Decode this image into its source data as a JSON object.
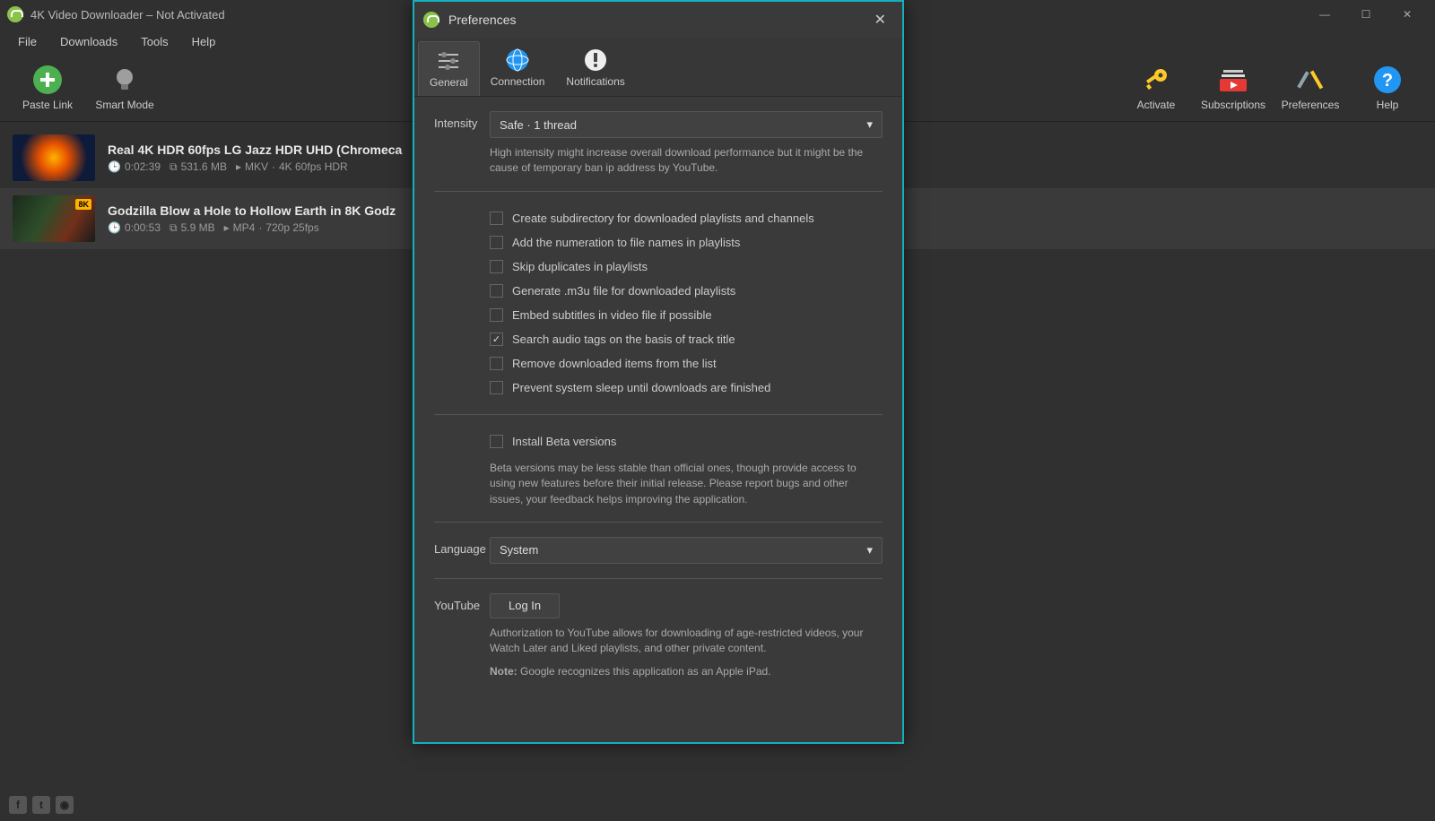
{
  "window": {
    "title": "4K Video Downloader – Not Activated"
  },
  "menu": {
    "file": "File",
    "downloads": "Downloads",
    "tools": "Tools",
    "help": "Help"
  },
  "toolbar": {
    "paste": "Paste Link",
    "smart": "Smart Mode",
    "activate": "Activate",
    "subscriptions": "Subscriptions",
    "preferences": "Preferences",
    "help": "Help"
  },
  "downloads": [
    {
      "title": "Real 4K HDR 60fps LG Jazz HDR UHD (Chromeca",
      "duration": "0:02:39",
      "size": "531.6 MB",
      "container": "MKV",
      "quality": "4K 60fps  HDR"
    },
    {
      "title": "Godzilla Blow a Hole to Hollow Earth in 8K   Godz",
      "duration": "0:00:53",
      "size": "5.9 MB",
      "container": "MP4",
      "quality": "720p 25fps"
    }
  ],
  "prefs": {
    "title": "Preferences",
    "tabs": {
      "general": "General",
      "connection": "Connection",
      "notifications": "Notifications"
    },
    "intensity": {
      "label": "Intensity",
      "value": "Safe · 1 thread",
      "hint": "High intensity might increase overall download performance but it might be the cause of temporary ban ip address by YouTube."
    },
    "checks": {
      "subdir": "Create subdirectory for downloaded playlists and channels",
      "numeration": "Add the numeration to file names in playlists",
      "skipdup": "Skip duplicates in playlists",
      "m3u": "Generate .m3u file for downloaded playlists",
      "embedsub": "Embed subtitles in video file if possible",
      "audiotags": "Search audio tags on the basis of track title",
      "removeitems": "Remove downloaded items from the list",
      "preventsleep": "Prevent system sleep until downloads are finished",
      "beta": "Install Beta versions"
    },
    "beta_hint": "Beta versions may be less stable than official ones, though provide access to using new features before their initial release. Please report bugs and other issues, your feedback helps improving the application.",
    "language": {
      "label": "Language",
      "value": "System"
    },
    "youtube": {
      "label": "YouTube",
      "login": "Log In",
      "hint": "Authorization to YouTube allows for downloading of age-restricted videos, your Watch Later and Liked playlists, and other private content.",
      "note_label": "Note:",
      "note": "Google recognizes this application as an Apple iPad."
    }
  }
}
